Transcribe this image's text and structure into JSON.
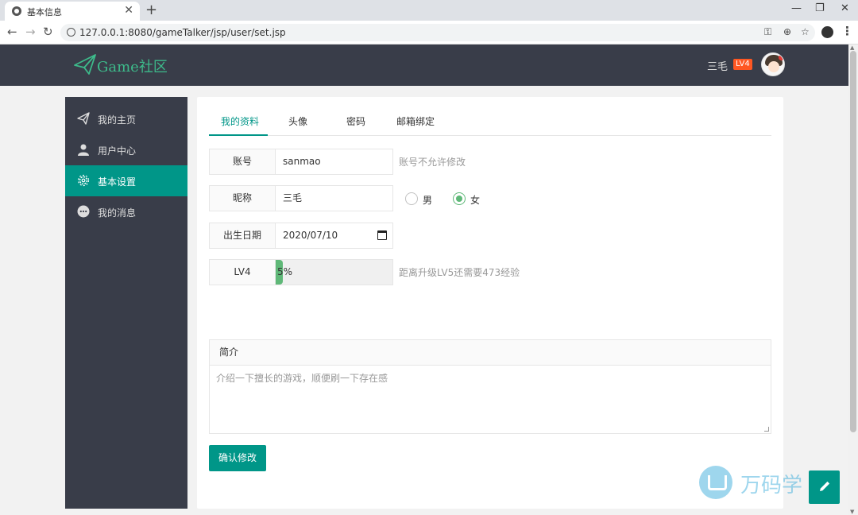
{
  "browser": {
    "tab_title": "基本信息",
    "tab_close": "✕",
    "new_tab": "+",
    "url": "127.0.0.1:8080/gameTalker/jsp/user/set.jsp",
    "minimize": "—",
    "restore": "❐",
    "close": "✕"
  },
  "header": {
    "logo_text": "Game社区",
    "user_name": "三毛",
    "level_badge": "LV4"
  },
  "sidebar": {
    "items": [
      {
        "label": "我的主页",
        "icon": "paper-plane-icon"
      },
      {
        "label": "用户中心",
        "icon": "user-icon"
      },
      {
        "label": "基本设置",
        "icon": "gear-icon",
        "active": true
      },
      {
        "label": "我的消息",
        "icon": "chat-bubble-icon"
      }
    ]
  },
  "tabs": [
    {
      "label": "我的资料",
      "active": true
    },
    {
      "label": "头像"
    },
    {
      "label": "密码"
    },
    {
      "label": "邮箱绑定"
    }
  ],
  "form": {
    "account_label": "账号",
    "account_value": "sanmao",
    "account_note": "账号不允许修改",
    "nickname_label": "昵称",
    "nickname_value": "三毛",
    "gender_options": [
      "男",
      "女"
    ],
    "gender_selected": "女",
    "birthday_label": "出生日期",
    "birthday_value": "2020/07/10",
    "level_label": "LV4",
    "level_progress": 5,
    "level_progress_text": "5%",
    "level_note": "距离升级LV5还需要473经验",
    "intro_label": "简介",
    "intro_placeholder": "介绍一下擅长的游戏，顺便刷一下存在感",
    "submit_label": "确认修改"
  },
  "watermark": {
    "text": "万码学"
  },
  "colors": {
    "accent": "#009688",
    "header_bg": "#393d49",
    "radio_on": "#5fb878",
    "badge": "#ff5722"
  }
}
